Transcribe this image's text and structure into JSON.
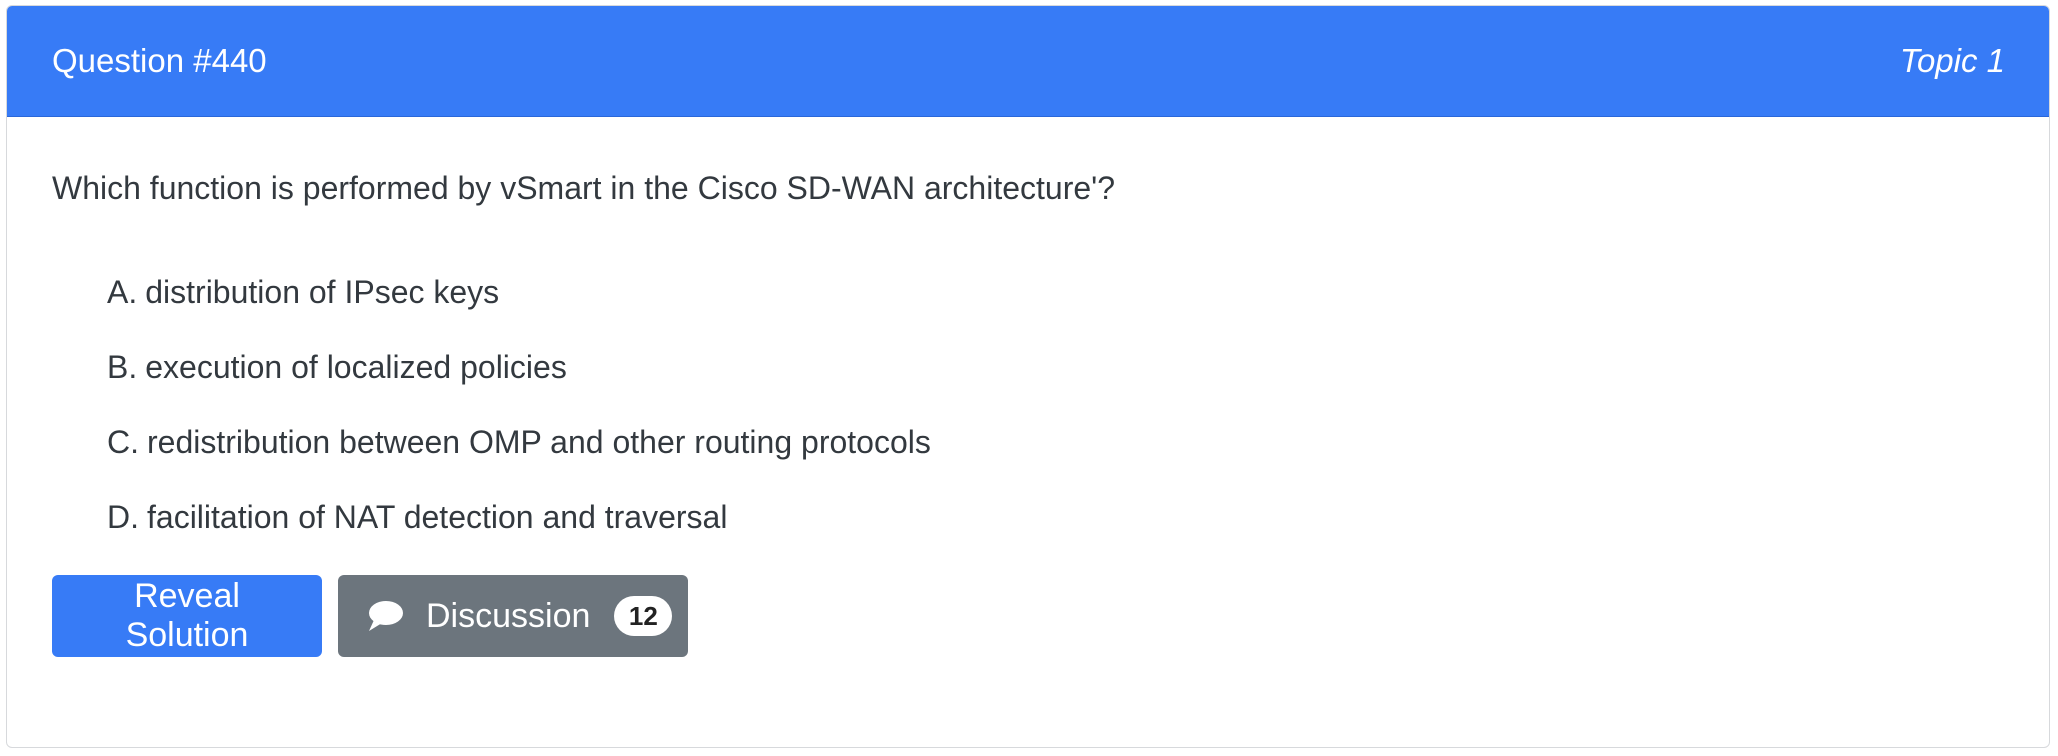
{
  "header": {
    "question_label": "Question #440",
    "topic_label": "Topic 1"
  },
  "question": {
    "text": "Which function is performed by vSmart in the Cisco SD-WAN architecture'?",
    "choices": [
      {
        "letter": "A.",
        "text": "distribution of IPsec keys"
      },
      {
        "letter": "B.",
        "text": "execution of localized policies"
      },
      {
        "letter": "C.",
        "text": "redistribution between OMP and other routing protocols"
      },
      {
        "letter": "D.",
        "text": "facilitation of NAT detection and traversal"
      }
    ]
  },
  "actions": {
    "reveal_label": "Reveal Solution",
    "discussion_label": "Discussion",
    "discussion_count": "12",
    "discussion_icon": "comment-icon"
  },
  "colors": {
    "primary": "#377bf6",
    "secondary": "#6c757d",
    "text": "#33393f"
  }
}
